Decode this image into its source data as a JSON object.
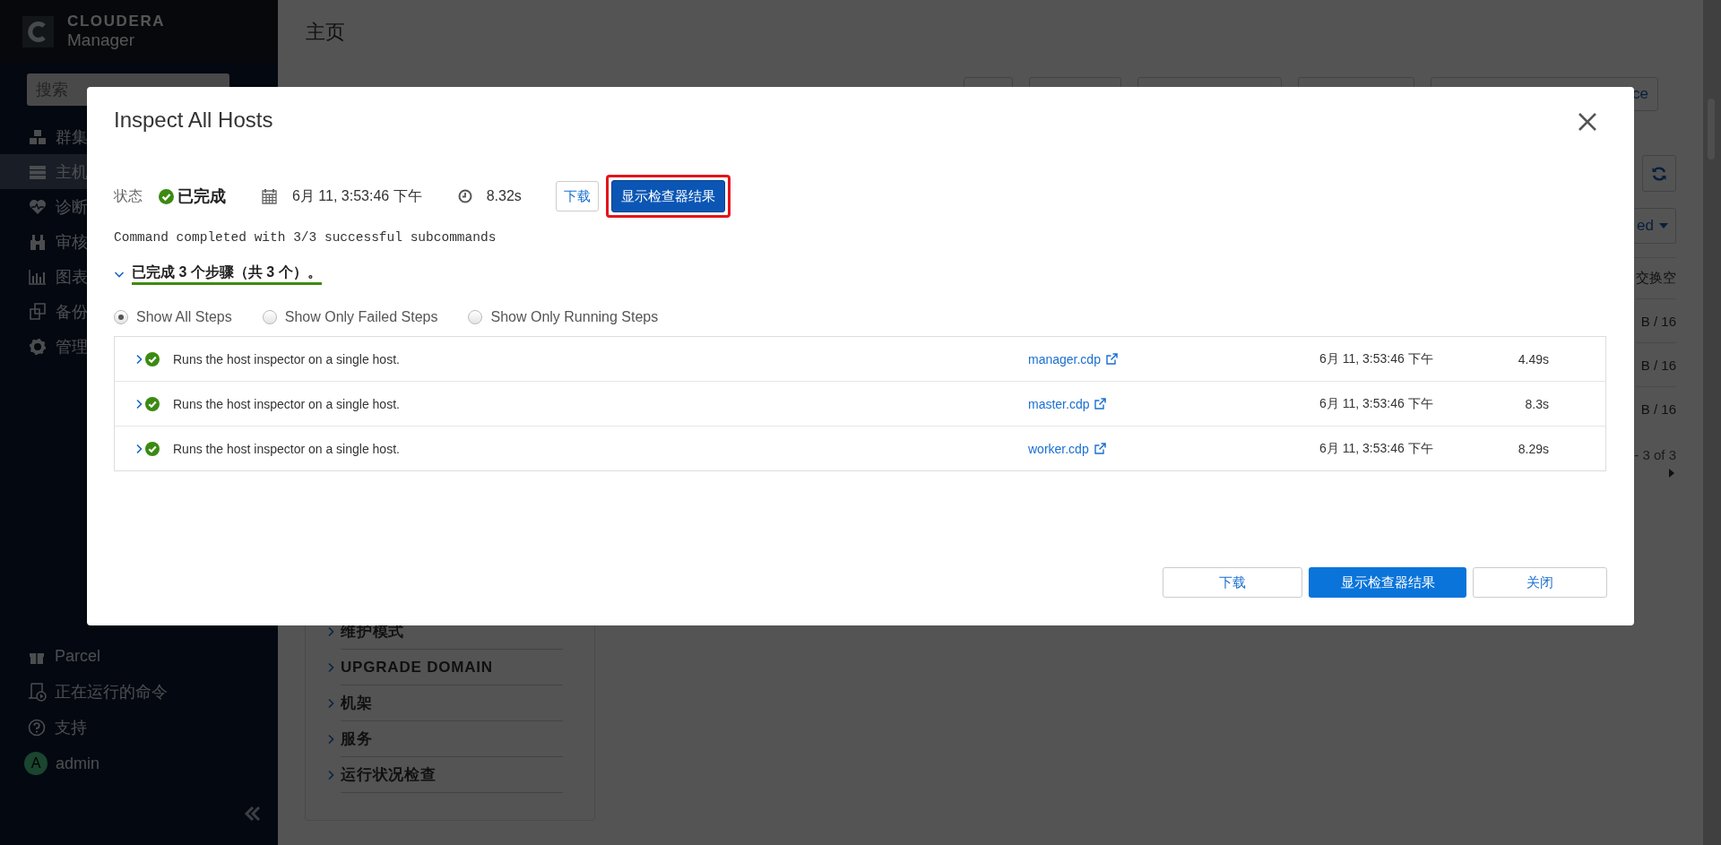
{
  "sidebar": {
    "brand": "CLOUDERA",
    "product": "Manager",
    "search": {
      "placeholder": "搜索"
    },
    "nav_items": [
      {
        "label": "群集",
        "selected": false
      },
      {
        "label": "主机",
        "selected": true
      },
      {
        "label": "诊断",
        "selected": false
      },
      {
        "label": "审核",
        "selected": false
      },
      {
        "label": "图表",
        "selected": false
      },
      {
        "label": "备份",
        "selected": false
      },
      {
        "label": "管理",
        "selected": false
      }
    ],
    "bottom_items": [
      {
        "label": "Parcel"
      },
      {
        "label": "正在运行的命令"
      },
      {
        "label": "支持"
      }
    ],
    "user": {
      "initial": "A",
      "name": "admin"
    }
  },
  "page": {
    "breadcrumb": "主页",
    "toolbar_button": "ce",
    "view_dropdown": "ed",
    "column_header": "交换空",
    "cells": [
      "B / 16",
      "B / 16",
      "B / 16"
    ],
    "pagination": "- 3 of 3",
    "filters": [
      {
        "label": "维护模式",
        "expanded": false
      },
      {
        "label": "UPGRADE DOMAIN",
        "expanded": false
      },
      {
        "label": "机架",
        "expanded": false
      },
      {
        "label": "服务",
        "expanded": false
      },
      {
        "label": "运行状况检查",
        "expanded": false
      }
    ]
  },
  "dialog": {
    "title": "Inspect All Hosts",
    "status": {
      "label": "状态",
      "value": "已完成",
      "date": "6月 11, 3:53:46 下午",
      "duration": "8.32s"
    },
    "header_buttons": [
      {
        "label": "下载",
        "kind": "default",
        "highlighted": false
      },
      {
        "label": "显示检查器结果",
        "kind": "primary",
        "highlighted": true
      }
    ],
    "message": "Command completed with 3/3 successful subcommands",
    "steps_summary": {
      "text": "已完成 3 个步骤（共 3 个）。",
      "expanded": true
    },
    "filters": [
      {
        "label": "Show All Steps",
        "selected": true
      },
      {
        "label": "Show Only Failed Steps",
        "selected": false
      },
      {
        "label": "Show Only Running Steps",
        "selected": false
      }
    ],
    "steps": [
      {
        "expanded": false,
        "description": "Runs the host inspector on a single host.",
        "host": "manager.cdp",
        "time": "6月 11, 3:53:46 下午",
        "duration": "4.49s"
      },
      {
        "expanded": false,
        "description": "Runs the host inspector on a single host.",
        "host": "master.cdp",
        "time": "6月 11, 3:53:46 下午",
        "duration": "8.3s"
      },
      {
        "expanded": false,
        "description": "Runs the host inspector on a single host.",
        "host": "worker.cdp",
        "time": "6月 11, 3:53:46 下午",
        "duration": "8.29s"
      }
    ],
    "footer_buttons": [
      {
        "label": "下载",
        "kind": "default"
      },
      {
        "label": "显示检查器结果",
        "kind": "primary"
      },
      {
        "label": "关闭",
        "kind": "default"
      }
    ]
  }
}
